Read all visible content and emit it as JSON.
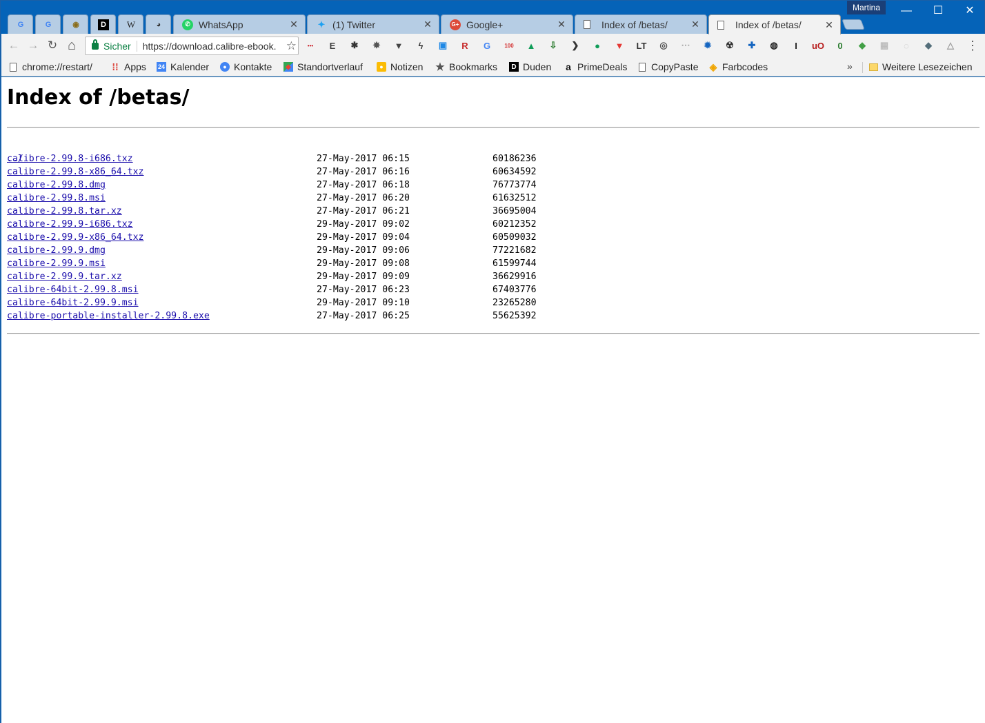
{
  "window": {
    "profile_name": "Martina",
    "controls": {
      "minimize": "—",
      "maximize": "☐",
      "close": "✕"
    }
  },
  "tabs": [
    {
      "kind": "pinned",
      "icon": "google-icon",
      "glyph": "G",
      "color": "#4285f4"
    },
    {
      "kind": "pinned",
      "icon": "google-translate-icon",
      "glyph": "G",
      "color": "#4285f4"
    },
    {
      "kind": "pinned",
      "icon": "owl-icon",
      "glyph": "◉",
      "color": "#8a6d1a"
    },
    {
      "kind": "pinned",
      "icon": "duden-icon",
      "glyph": "D",
      "color": "#000000"
    },
    {
      "kind": "pinned",
      "icon": "wikipedia-icon",
      "glyph": "W",
      "color": "#222222"
    },
    {
      "kind": "pinned",
      "icon": "panda-icon",
      "glyph": "◕",
      "color": "#333333"
    },
    {
      "kind": "tab",
      "label": "WhatsApp",
      "icon": "whatsapp-icon",
      "glyph": "✆",
      "color": "#25d366"
    },
    {
      "kind": "tab",
      "label": "(1) Twitter",
      "icon": "twitter-icon",
      "glyph": "✦",
      "color": "#1da1f2"
    },
    {
      "kind": "tab",
      "label": "Google+",
      "icon": "google-plus-icon",
      "glyph": "G+",
      "color": "#dd4b39"
    },
    {
      "kind": "tab",
      "label": "Index of /betas/",
      "icon": "page-icon",
      "glyph": "",
      "color": "#666666"
    },
    {
      "kind": "tab",
      "label": "Index of /betas/",
      "icon": "page-icon",
      "glyph": "",
      "color": "#666666",
      "active": true
    }
  ],
  "toolbar": {
    "back": "←",
    "forward": "→",
    "reload": "↻",
    "home": "⌂",
    "secure_label": "Sicher",
    "url": "https://download.calibre-ebook.",
    "bookmark_star": "☆",
    "menu": "⋮"
  },
  "extensions": [
    {
      "icon": "lastpass-icon",
      "color": "#cc2029",
      "glyph": "•••"
    },
    {
      "icon": "evernote-icon",
      "color": "#3d3d3d",
      "glyph": "E"
    },
    {
      "icon": "settings-icon",
      "color": "#333333",
      "glyph": "✱"
    },
    {
      "icon": "bug-icon",
      "color": "#555555",
      "glyph": "✸"
    },
    {
      "icon": "pocket-icon",
      "color": "#444444",
      "glyph": "▼"
    },
    {
      "icon": "lightning-icon",
      "color": "#333333",
      "glyph": "ϟ"
    },
    {
      "icon": "screenshot-icon",
      "color": "#1e88e5",
      "glyph": "▣"
    },
    {
      "icon": "abp-icon",
      "color": "#c62828",
      "glyph": "R"
    },
    {
      "icon": "translate-icon",
      "color": "#4285f4",
      "glyph": "G"
    },
    {
      "icon": "z100-icon",
      "color": "#d32f2f",
      "glyph": "100"
    },
    {
      "icon": "google-drive-icon",
      "color": "#0f9d58",
      "glyph": "▲"
    },
    {
      "icon": "download-icon",
      "color": "#2e7d32",
      "glyph": "⇩"
    },
    {
      "icon": "code-icon",
      "color": "#333333",
      "glyph": "❯"
    },
    {
      "icon": "hangouts-icon",
      "color": "#0f9d58",
      "glyph": "●"
    },
    {
      "icon": "vivaldi-icon",
      "color": "#e53935",
      "glyph": "▼"
    },
    {
      "icon": "languagetool-icon",
      "color": "#333333",
      "glyph": "LT"
    },
    {
      "icon": "lightbulb-icon",
      "color": "#555555",
      "glyph": "◎"
    },
    {
      "icon": "dots-icon",
      "color": "#aaaaaa",
      "glyph": "⋯"
    },
    {
      "icon": "gear-blue-icon",
      "color": "#1565c0",
      "glyph": "✹"
    },
    {
      "icon": "radiation-icon",
      "color": "#333333",
      "glyph": "☢"
    },
    {
      "icon": "grid-icon",
      "color": "#1565c0",
      "glyph": "✚"
    },
    {
      "icon": "circle-p-icon",
      "color": "#222222",
      "glyph": "◍"
    },
    {
      "icon": "italic-i-icon",
      "color": "#222222",
      "glyph": "I"
    },
    {
      "icon": "ublock-icon",
      "color": "#b71c1c",
      "glyph": "uO"
    },
    {
      "icon": "frog-icon",
      "color": "#2e7d32",
      "glyph": "0"
    },
    {
      "icon": "puzzle-color-icon",
      "color": "#43a047",
      "glyph": "◆"
    },
    {
      "icon": "gray-grid-icon",
      "color": "#bdbdbd",
      "glyph": "▦"
    },
    {
      "icon": "gray-circle-icon",
      "color": "#bdbdbd",
      "glyph": "◌"
    },
    {
      "icon": "drop-icon",
      "color": "#546e7a",
      "glyph": "◆"
    },
    {
      "icon": "triangle-icon",
      "color": "#9e9e9e",
      "glyph": "△"
    }
  ],
  "bookmarks": {
    "items": [
      {
        "label": "chrome://restart/",
        "icon": "page-icon"
      },
      {
        "label": "Apps",
        "icon": "apps-grid-icon"
      },
      {
        "label": "Kalender",
        "icon": "calendar-icon",
        "glyph": "24"
      },
      {
        "label": "Kontakte",
        "icon": "contacts-icon"
      },
      {
        "label": "Standortverlauf",
        "icon": "maps-icon"
      },
      {
        "label": "Notizen",
        "icon": "keep-icon"
      },
      {
        "label": "Bookmarks",
        "icon": "star-icon"
      },
      {
        "label": "Duden",
        "icon": "duden-icon",
        "glyph": "D"
      },
      {
        "label": "PrimeDeals",
        "icon": "amazon-icon",
        "glyph": "a"
      },
      {
        "label": "CopyPaste",
        "icon": "page-icon"
      },
      {
        "label": "Farbcodes",
        "icon": "diamond-icon"
      }
    ],
    "more": "»",
    "other_folder": "Weitere Lesezeichen"
  },
  "page": {
    "title": "Index of /betas/",
    "parent_link": "../",
    "files": [
      {
        "name": "calibre-2.99.8-i686.txz",
        "date": "27-May-2017 06:15",
        "size": "60186236"
      },
      {
        "name": "calibre-2.99.8-x86_64.txz",
        "date": "27-May-2017 06:16",
        "size": "60634592"
      },
      {
        "name": "calibre-2.99.8.dmg",
        "date": "27-May-2017 06:18",
        "size": "76773774"
      },
      {
        "name": "calibre-2.99.8.msi",
        "date": "27-May-2017 06:20",
        "size": "61632512"
      },
      {
        "name": "calibre-2.99.8.tar.xz",
        "date": "27-May-2017 06:21",
        "size": "36695004"
      },
      {
        "name": "calibre-2.99.9-i686.txz",
        "date": "29-May-2017 09:02",
        "size": "60212352"
      },
      {
        "name": "calibre-2.99.9-x86_64.txz",
        "date": "29-May-2017 09:04",
        "size": "60509032"
      },
      {
        "name": "calibre-2.99.9.dmg",
        "date": "29-May-2017 09:06",
        "size": "77221682"
      },
      {
        "name": "calibre-2.99.9.msi",
        "date": "29-May-2017 09:08",
        "size": "61599744"
      },
      {
        "name": "calibre-2.99.9.tar.xz",
        "date": "29-May-2017 09:09",
        "size": "36629916"
      },
      {
        "name": "calibre-64bit-2.99.8.msi",
        "date": "27-May-2017 06:23",
        "size": "67403776"
      },
      {
        "name": "calibre-64bit-2.99.9.msi",
        "date": "29-May-2017 09:10",
        "size": "23265280"
      },
      {
        "name": "calibre-portable-installer-2.99.8.exe",
        "date": "27-May-2017 06:25",
        "size": "55625392"
      }
    ]
  }
}
